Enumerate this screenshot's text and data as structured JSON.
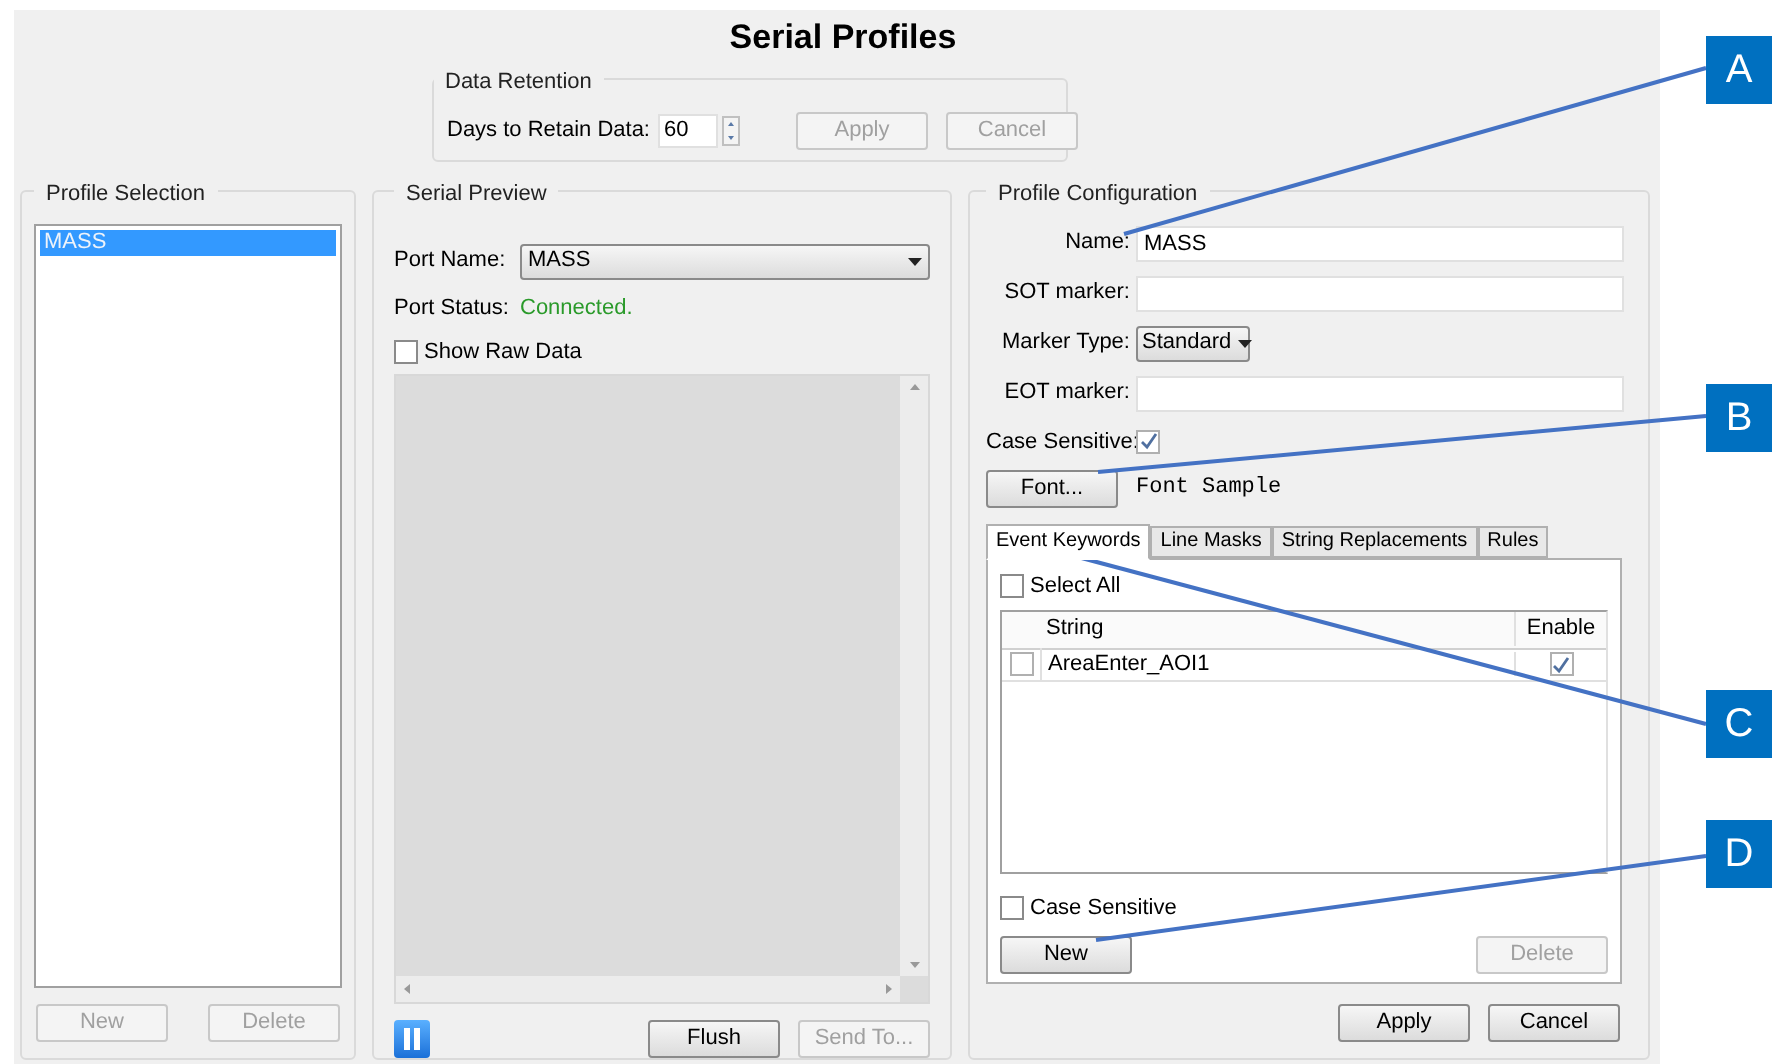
{
  "window": {
    "title": "Serial Profiles"
  },
  "data_retention": {
    "title": "Data Retention",
    "days_label": "Days to Retain Data:",
    "days_value": "60",
    "buttons": [
      {
        "label": "Apply",
        "disabled": true
      },
      {
        "label": "Cancel",
        "disabled": true
      }
    ]
  },
  "profile_selection": {
    "title": "Profile Selection",
    "items": [
      {
        "label": "MASS",
        "selected": true
      }
    ],
    "buttons": [
      {
        "label": "New",
        "disabled": true
      },
      {
        "label": "Delete",
        "disabled": true
      }
    ]
  },
  "serial_preview": {
    "title": "Serial Preview",
    "port_name_label": "Port Name:",
    "port_name_value": "MASS",
    "port_status_label": "Port Status:",
    "port_status_value": "Connected.",
    "show_raw_data": {
      "label": "Show Raw Data",
      "checked": false
    },
    "buttons": [
      {
        "label": "Flush",
        "disabled": false
      },
      {
        "label": "Send To...",
        "disabled": true
      }
    ]
  },
  "profile_configuration": {
    "title": "Profile Configuration",
    "fields": [
      {
        "kind": "text",
        "label": "Name:",
        "value": "MASS"
      },
      {
        "kind": "text",
        "label": "SOT marker:"
      },
      {
        "kind": "select",
        "label": "Marker Type:",
        "value": "Standard"
      },
      {
        "kind": "text",
        "label": "EOT marker:"
      },
      {
        "kind": "checkbox",
        "label": "Case Sensitive:",
        "checked": true
      }
    ],
    "font_button": "Font...",
    "font_sample": "Font Sample",
    "tabs": [
      {
        "label": "Event Keywords",
        "selected": true
      },
      {
        "label": "Line Masks",
        "selected": false
      },
      {
        "label": "String Replacements",
        "selected": false
      },
      {
        "label": "Rules",
        "selected": false
      }
    ],
    "select_all": {
      "label": "Select All",
      "checked": false
    },
    "table": {
      "columns": [
        "String",
        "Enable"
      ],
      "rows": [
        {
          "checked": false,
          "string": "AreaEnter_AOI1",
          "enabled": true
        }
      ]
    },
    "case_sensitive": {
      "label": "Case Sensitive",
      "checked": false
    },
    "tab_buttons": [
      {
        "label": "New",
        "disabled": false
      },
      {
        "label": "Delete",
        "disabled": true
      }
    ],
    "buttons": [
      {
        "label": "Apply",
        "disabled": false
      },
      {
        "label": "Cancel",
        "disabled": false
      }
    ]
  },
  "callouts": [
    {
      "label": "A"
    },
    {
      "label": "B"
    },
    {
      "label": "C"
    },
    {
      "label": "D"
    }
  ]
}
